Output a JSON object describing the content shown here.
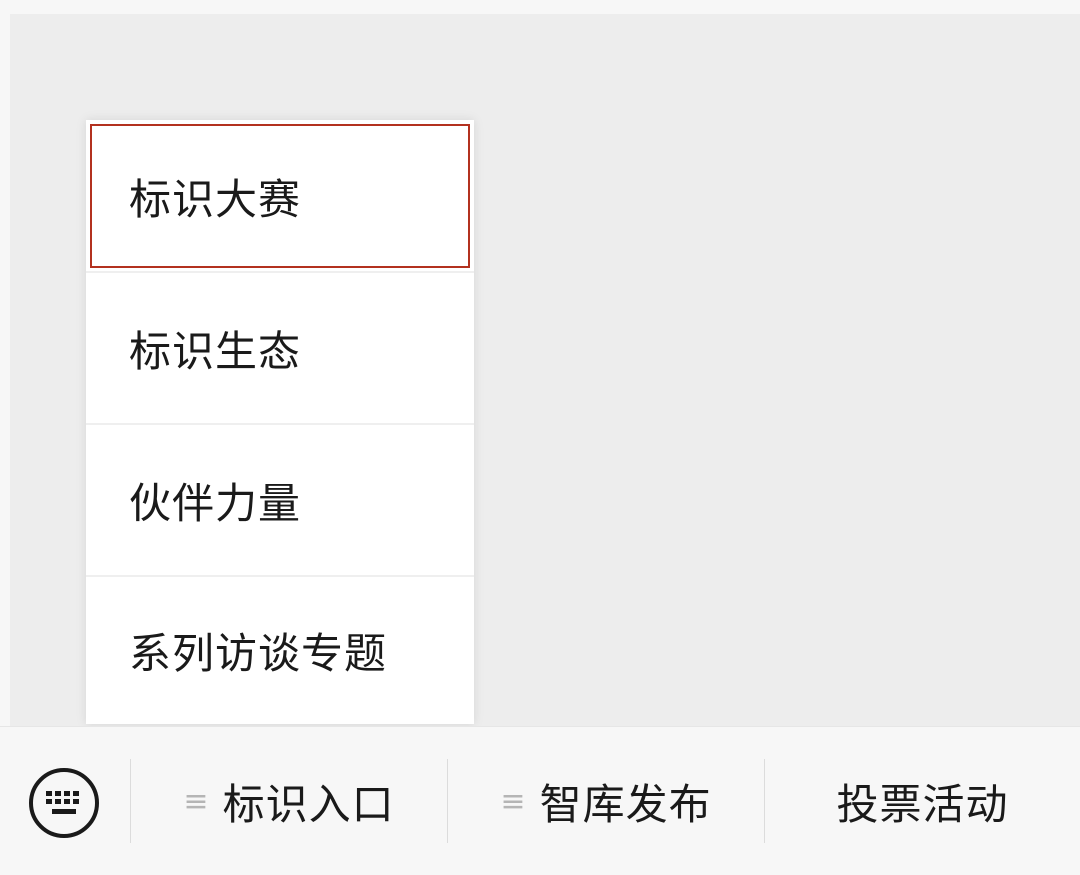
{
  "popup_menu": {
    "items": [
      {
        "label": "标识大赛",
        "selected": true
      },
      {
        "label": "标识生态",
        "selected": false
      },
      {
        "label": "伙伴力量",
        "selected": false
      },
      {
        "label": "系列访谈专题",
        "selected": false
      }
    ]
  },
  "bottom_bar": {
    "keyboard_icon": "keyboard-icon",
    "submenu_glyph": "≡",
    "menus": [
      {
        "label": "标识入口",
        "has_submenu": true
      },
      {
        "label": "智库发布",
        "has_submenu": true
      },
      {
        "label": "投票活动",
        "has_submenu": false
      }
    ]
  },
  "colors": {
    "selected_border": "#b3311f",
    "background": "#ededed",
    "bar_background": "#f7f7f7"
  }
}
